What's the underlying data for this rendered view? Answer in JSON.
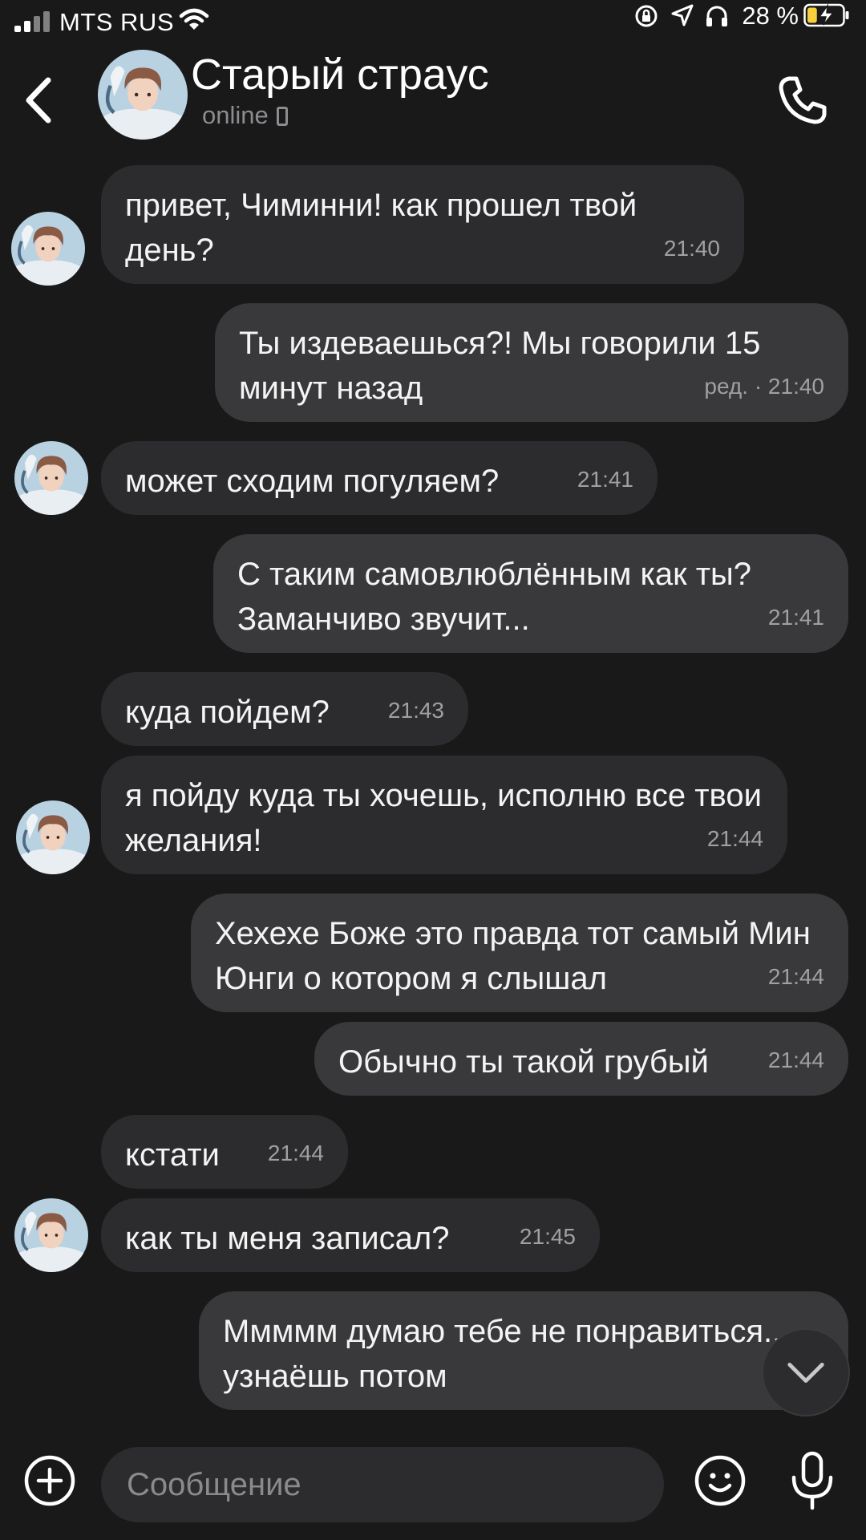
{
  "status_bar": {
    "carrier": "MTS RUS",
    "battery_percent": "28 %",
    "battery_level": 0.28,
    "battery_color": "#f7cf3d",
    "icons": [
      "signal-icon",
      "wifi-icon",
      "rotation-lock-icon",
      "location-icon",
      "headphones-icon",
      "battery-charging-icon"
    ]
  },
  "header": {
    "back_icon": "chevron-left-icon",
    "title": "Старый страус",
    "status": "online",
    "status_icon": "mobile-phone-icon",
    "call_icon": "phone-icon"
  },
  "messages": [
    {
      "dir": "in",
      "text": "привет, Чиминни! как прошел твой день?",
      "time": "21:40"
    },
    {
      "dir": "out",
      "text": "Ты издеваешься?! Мы говорили 15 минут назад",
      "time": "ред. · 21:40"
    },
    {
      "dir": "in",
      "text": "может сходим погуляем?",
      "time": "21:41"
    },
    {
      "dir": "out",
      "text": "С таким самовлюблённым как ты? Заманчиво звучит...",
      "time": "21:41"
    },
    {
      "dir": "in",
      "text": "куда пойдем?",
      "time": "21:43"
    },
    {
      "dir": "in",
      "text": "я пойду куда ты хочешь, исполню все твои желания!",
      "time": "21:44"
    },
    {
      "dir": "out",
      "text": "Хехехе Боже это правда тот самый Мин Юнги о котором я слышал",
      "time": "21:44"
    },
    {
      "dir": "out",
      "text": "Обычно ты такой грубый",
      "time": "21:44"
    },
    {
      "dir": "in",
      "text": "кстати",
      "time": "21:44"
    },
    {
      "dir": "in",
      "text": "как ты меня записал?",
      "time": "21:45"
    },
    {
      "dir": "out",
      "text": "Ммммм думаю тебе не понравиться.... узнаёшь потом",
      "time": ""
    }
  ],
  "scroll_down_icon": "chevron-down-icon",
  "composer": {
    "placeholder": "Сообщение",
    "attach_icon": "plus-circle-icon",
    "emoji_icon": "smiley-icon",
    "mic_icon": "microphone-icon"
  },
  "colors": {
    "background": "#19191a",
    "incoming_bubble": "#2c2c2e",
    "outgoing_bubble": "#39393b",
    "secondary_text": "#8c8c90"
  }
}
